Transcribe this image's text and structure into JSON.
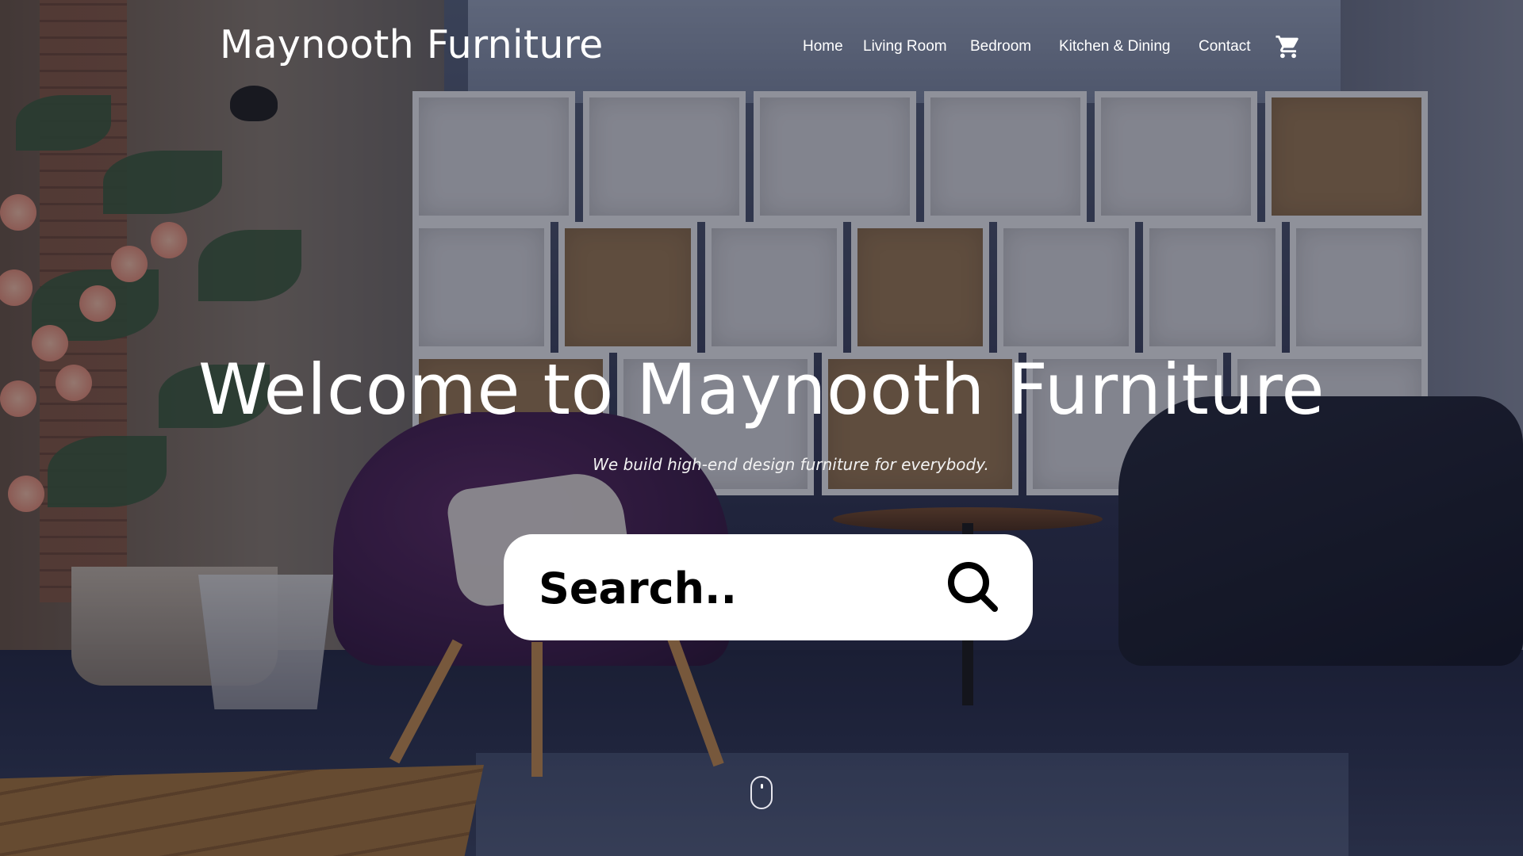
{
  "header": {
    "brand": "Maynooth Furniture",
    "nav": [
      {
        "label": "Home"
      },
      {
        "label": "Living Room"
      },
      {
        "label": "Bedroom"
      },
      {
        "label": "Kitchen & Dining"
      },
      {
        "label": "Contact"
      }
    ],
    "cart_icon": "shopping-cart-icon"
  },
  "hero": {
    "title": "Welcome to Maynooth Furniture",
    "subtitle": "We build high-end design furniture for everybody.",
    "search": {
      "placeholder": "Search..",
      "value": "",
      "icon": "search-icon"
    },
    "scroll_icon": "mouse-scroll-icon"
  },
  "colors": {
    "text": "#ffffff",
    "search_bg": "#ffffff",
    "search_text": "#000000",
    "overlay": "#0c0e20"
  }
}
